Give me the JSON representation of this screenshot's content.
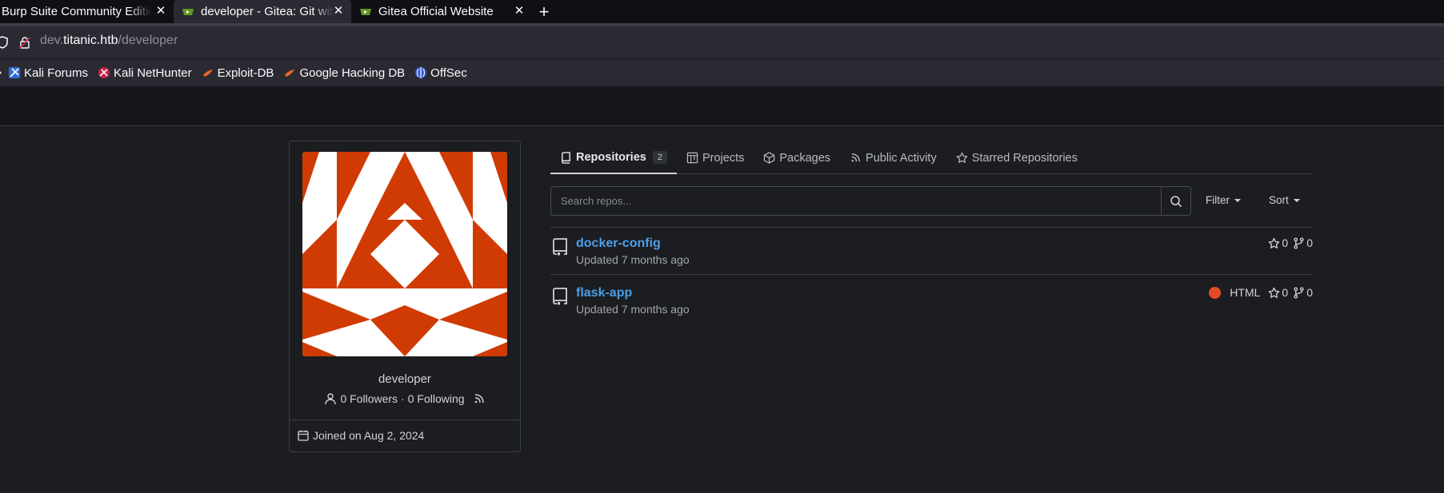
{
  "browser": {
    "tabs": [
      {
        "title": "Burp Suite Community Edition",
        "close": "✕",
        "favicon": "none"
      },
      {
        "title": "developer - Gitea: Git with a cup of tea",
        "close": "✕",
        "favicon": "gitea-icon"
      },
      {
        "title": "Gitea Official Website",
        "close": "✕",
        "favicon": "gitea-icon"
      }
    ],
    "new_tab": "+",
    "url": {
      "prefix": "dev.",
      "host": "titanic.htb",
      "path": "/developer"
    },
    "bookmarks": [
      {
        "label": "Kali Forums",
        "icon": "kali-forums-icon"
      },
      {
        "label": "Kali NetHunter",
        "icon": "kali-nethunter-icon"
      },
      {
        "label": "Exploit-DB",
        "icon": "exploit-db-icon"
      },
      {
        "label": "Google Hacking DB",
        "icon": "ghdb-icon"
      },
      {
        "label": "OffSec",
        "icon": "offsec-icon"
      }
    ]
  },
  "profile": {
    "username": "developer",
    "followers": "0 Followers",
    "separator": "·",
    "following": "0 Following",
    "joined": "Joined on Aug 2, 2024",
    "avatar_color": "#d03b03"
  },
  "tabs": [
    {
      "label": "Repositories",
      "count": "2",
      "icon": "repo-icon",
      "active": true
    },
    {
      "label": "Projects",
      "icon": "project-icon"
    },
    {
      "label": "Packages",
      "icon": "package-icon"
    },
    {
      "label": "Public Activity",
      "icon": "rss-icon"
    },
    {
      "label": "Starred Repositories",
      "icon": "star-icon"
    }
  ],
  "search": {
    "placeholder": "Search repos...",
    "value": ""
  },
  "filter_label": "Filter",
  "sort_label": "Sort",
  "repos": [
    {
      "name": "docker-config",
      "updated": "Updated 7 months ago",
      "stars": "0",
      "forks": "0"
    },
    {
      "name": "flask-app",
      "updated": "Updated 7 months ago",
      "language": "HTML",
      "language_color": "#e34c26",
      "stars": "0",
      "forks": "0"
    }
  ],
  "colors": {
    "link": "#4b9fe8",
    "background": "#1c1d21",
    "header": "#16171b"
  }
}
